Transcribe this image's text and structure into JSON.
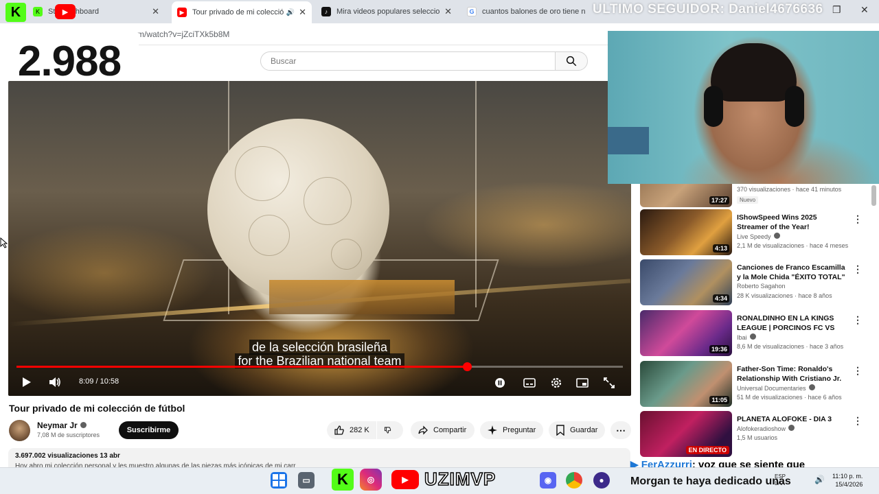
{
  "browser": {
    "tabs": [
      {
        "label": "Stream Kick Dashboard",
        "visible_label": "Str     ki   ashboard",
        "icon": "kick-icon",
        "color": "#53fc18",
        "active": false
      },
      {
        "label": "Tour privado de mi colecció",
        "icon": "youtube-icon",
        "color": "#ff0000",
        "active": true,
        "audio": true
      },
      {
        "label": "Mira videos populares seleccion",
        "icon": "tiktok-icon",
        "color": "#111111",
        "active": false
      },
      {
        "label": "cuantos balones de oro tiene n",
        "icon": "google-icon",
        "color": "#4285f4",
        "active": false
      }
    ],
    "url": "m/watch?v=jZciTXk5b8M"
  },
  "overlay": {
    "counter": "2.988",
    "seguidor": "ULTIMO SEGUIDOR: Daniel4676636",
    "ticker_user": "FerAzzurri",
    "ticker_text": ": voz que se siente que",
    "bottom_text": "Morgan te haya dedicado unas",
    "brand": "UZIMVP"
  },
  "search": {
    "placeholder": "Buscar"
  },
  "video": {
    "subtitle_es": "de la selección brasileña",
    "subtitle_en": "for the Brazilian national team",
    "time": "8:09 / 10:58",
    "progress": 0.7427,
    "title": "Tour privado de mi colección de fútbol"
  },
  "channel": {
    "name": "Neymar Jr",
    "subscribers": "7,08 M de suscriptores",
    "subscribe_label": "Suscribirme"
  },
  "actions": {
    "likes": "282 K",
    "share": "Compartir",
    "ask": "Preguntar",
    "save": "Guardar"
  },
  "description": {
    "stats": "3.697.002 visualizaciones  13 abr",
    "text": "Hoy abro mi colección personal y les muestro algunas de las piezas más icónicas de mi carr"
  },
  "recommendations": [
    {
      "title": "",
      "channel": "",
      "meta": "370 visualizaciones · hace 41 minutos",
      "badge": "Nuevo",
      "duration": "17:27"
    },
    {
      "title": "IShowSpeed Wins 2025 Streamer of the Year!",
      "channel": "Live Speedy",
      "meta": "2,1 M de visualizaciones · hace 4 meses",
      "duration": "4:13"
    },
    {
      "title": "Canciones de Franco Escamilla y la Mole Chida \"ÉXITO TOTAL\"",
      "channel": "Roberto Sagahon",
      "meta": "28 K visualizaciones · hace 8 años",
      "duration": "4:34"
    },
    {
      "title": "RONALDINHO EN LA KINGS LEAGUE | PORCINOS FC VS PI...",
      "channel": "Ibai",
      "meta": "8,6 M de visualizaciones · hace 3 años",
      "duration": "19:36"
    },
    {
      "title": "Father-Son Time: Ronaldo's Relationship With Cristiano Jr. ...",
      "channel": "Universal Documentaries",
      "meta": "51 M de visualizaciones · hace 6 años",
      "duration": "11:05"
    },
    {
      "title": "PLANETA ALOFOKE - DIA 3",
      "channel": "Alofokeradioshow",
      "meta": "1,5 M usuarios",
      "live": "EN DIRECTO"
    }
  ],
  "taskbar": {
    "lang": "ESP",
    "lang2": "LAA",
    "time": "11:10 p. m.",
    "date": "15/4/2026"
  }
}
